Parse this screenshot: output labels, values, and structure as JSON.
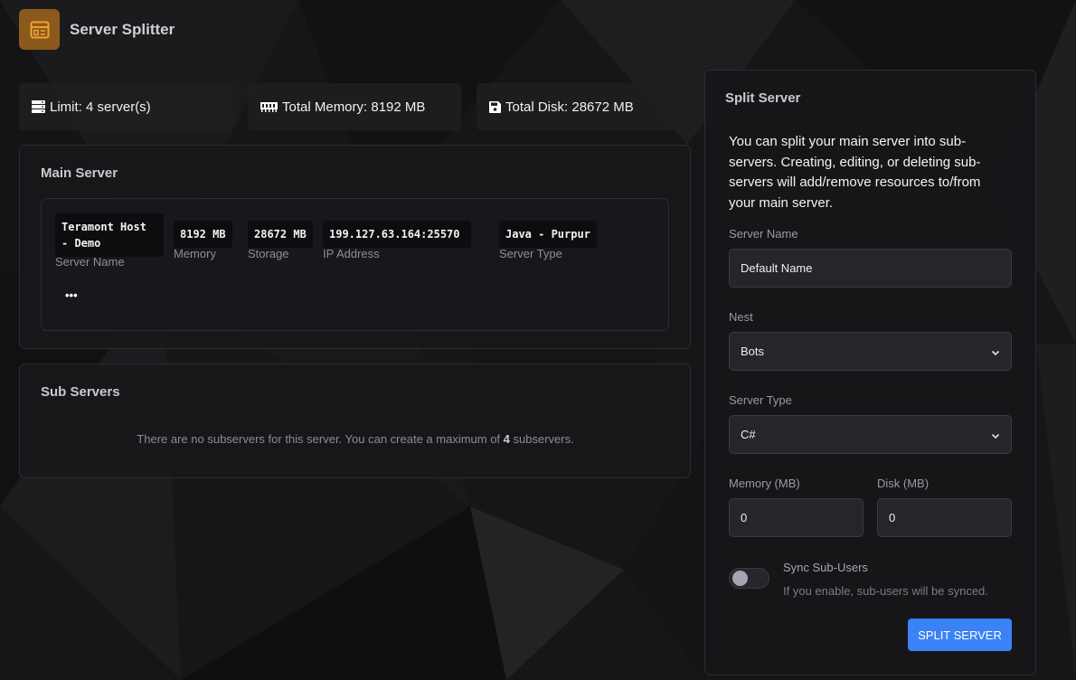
{
  "header": {
    "title": "Server Splitter",
    "icon": "layout-icon",
    "accent": "#8a5a1c"
  },
  "stats": {
    "limit": "Limit: 4 server(s)",
    "memory": "Total Memory: 8192 MB",
    "disk": "Total Disk: 28672 MB"
  },
  "main_server": {
    "title": "Main Server",
    "name_value": "Teramont Host - Demo",
    "name_label": "Server Name",
    "memory_value": "8192 MB",
    "memory_label": "Memory",
    "storage_value": "28672 MB",
    "storage_label": "Storage",
    "ip_value": "199.127.63.164:25570",
    "ip_label": "IP Address",
    "type_value": "Java - Purpur",
    "type_label": "Server Type",
    "more": "•••"
  },
  "sub_servers": {
    "title": "Sub Servers",
    "empty_prefix": "There are no subservers for this server. You can create a maximum of ",
    "empty_count": "4",
    "empty_suffix": " subservers."
  },
  "split_form": {
    "title": "Split Server",
    "description": "You can split your main server into sub-servers. Creating, editing, or deleting sub-servers will add/remove resources to/from your main server.",
    "server_name_label": "Server Name",
    "server_name_value": "Default Name",
    "nest_label": "Nest",
    "nest_value": "Bots",
    "server_type_label": "Server Type",
    "server_type_value": "C#",
    "memory_label": "Memory (MB)",
    "memory_value": "0",
    "disk_label": "Disk (MB)",
    "disk_value": "0",
    "sync_label": "Sync Sub-Users",
    "sync_help": "If you enable, sub-users will be synced.",
    "sync_enabled": false,
    "submit_label": "SPLIT SERVER",
    "submit_color": "#3b82f6"
  }
}
